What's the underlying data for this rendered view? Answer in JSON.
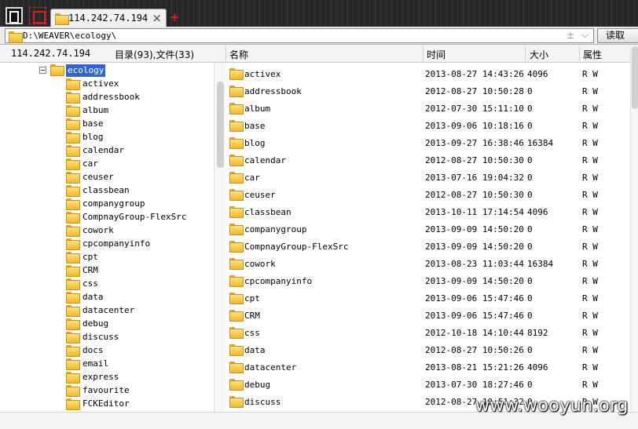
{
  "tab": {
    "title": "114.242.74.194",
    "close": "×",
    "add": "+"
  },
  "address": {
    "path": "D:\\WEAVER\\ecology\\",
    "pin": "±",
    "dropdown": "⌵",
    "read_button": "读取"
  },
  "left_header": {
    "host": "114.242.74.194",
    "count": "目录(93),文件(33)"
  },
  "columns": {
    "name": "名称",
    "time": "时间",
    "size": "大小",
    "attr": "属性"
  },
  "tree": {
    "root": "ecology",
    "items": [
      "activex",
      "addressbook",
      "album",
      "base",
      "blog",
      "calendar",
      "car",
      "ceuser",
      "classbean",
      "companygroup",
      "CompnayGroup-FlexSrc",
      "cowork",
      "cpcompanyinfo",
      "cpt",
      "CRM",
      "css",
      "data",
      "datacenter",
      "debug",
      "discuss",
      "docs",
      "email",
      "express",
      "favourite",
      "FCKEditor"
    ]
  },
  "files": [
    {
      "name": "activex",
      "time": "2013-08-27 14:43:26",
      "size": "4096",
      "attr": "R W"
    },
    {
      "name": "addressbook",
      "time": "2012-08-27 10:50:28",
      "size": "0",
      "attr": "R W"
    },
    {
      "name": "album",
      "time": "2012-07-30 15:11:10",
      "size": "0",
      "attr": "R W"
    },
    {
      "name": "base",
      "time": "2013-09-06 10:18:16",
      "size": "0",
      "attr": "R W"
    },
    {
      "name": "blog",
      "time": "2013-09-27 16:38:46",
      "size": "16384",
      "attr": "R W"
    },
    {
      "name": "calendar",
      "time": "2012-08-27 10:50:30",
      "size": "0",
      "attr": "R W"
    },
    {
      "name": "car",
      "time": "2013-07-16 19:04:32",
      "size": "0",
      "attr": "R W"
    },
    {
      "name": "ceuser",
      "time": "2012-08-27 10:50:30",
      "size": "0",
      "attr": "R W"
    },
    {
      "name": "classbean",
      "time": "2013-10-11 17:14:54",
      "size": "4096",
      "attr": "R W"
    },
    {
      "name": "companygroup",
      "time": "2013-09-09 14:50:20",
      "size": "0",
      "attr": "R W"
    },
    {
      "name": "CompnayGroup-FlexSrc",
      "time": "2013-09-09 14:50:20",
      "size": "0",
      "attr": "R W"
    },
    {
      "name": "cowork",
      "time": "2013-08-23 11:03:44",
      "size": "16384",
      "attr": "R W"
    },
    {
      "name": "cpcompanyinfo",
      "time": "2013-09-09 14:50:20",
      "size": "0",
      "attr": "R W"
    },
    {
      "name": "cpt",
      "time": "2013-09-06 15:47:46",
      "size": "0",
      "attr": "R W"
    },
    {
      "name": "CRM",
      "time": "2013-09-06 15:47:46",
      "size": "0",
      "attr": "R W"
    },
    {
      "name": "css",
      "time": "2012-10-18 14:10:44",
      "size": "8192",
      "attr": "R W"
    },
    {
      "name": "data",
      "time": "2012-08-27 10:50:26",
      "size": "0",
      "attr": "R W"
    },
    {
      "name": "datacenter",
      "time": "2013-08-21 15:21:26",
      "size": "4096",
      "attr": "R W"
    },
    {
      "name": "debug",
      "time": "2013-07-30 18:27:46",
      "size": "0",
      "attr": "R W"
    },
    {
      "name": "discuss",
      "time": "2012-08-27 10:51:32",
      "size": "0",
      "attr": "R W"
    }
  ],
  "watermark": "www.wooyun.org",
  "icons": {
    "folder": "folder-icon",
    "close": "close-icon",
    "add": "plus-icon"
  },
  "colors": {
    "selection": "#3366cc",
    "folder": "#f0b92e",
    "add": "#e02020"
  }
}
